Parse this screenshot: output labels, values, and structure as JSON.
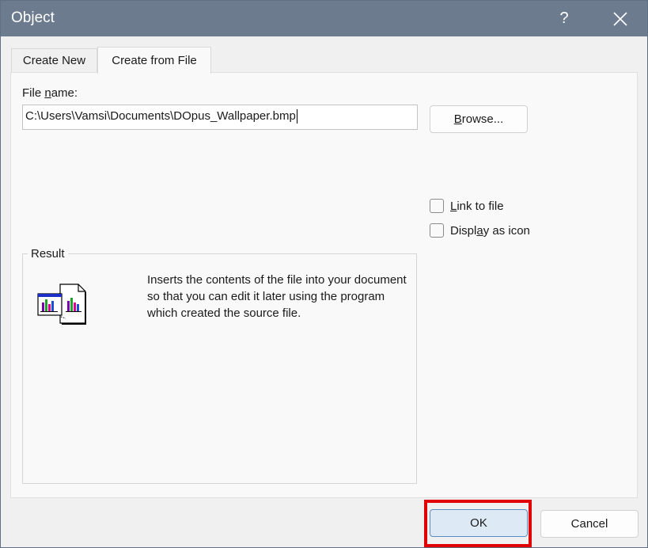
{
  "window": {
    "title": "Object",
    "help": "?",
    "close_icon": "close-icon"
  },
  "tabs": [
    {
      "label": "Create New",
      "selected": false
    },
    {
      "label": "Create from File",
      "selected": true
    }
  ],
  "file_name": {
    "label_prefix": "File ",
    "label_accel": "n",
    "label_suffix": "ame:",
    "value": "C:\\Users\\Vamsi\\Documents\\DOpus_Wallpaper.bmp"
  },
  "browse": {
    "accel": "B",
    "rest": "rowse..."
  },
  "options": {
    "link": {
      "accel": "L",
      "rest": "ink to file",
      "checked": false
    },
    "display_icon": {
      "pre": "Displ",
      "accel": "a",
      "rest": "y as icon",
      "checked": false
    }
  },
  "result": {
    "legend": "Result",
    "text": "Inserts the contents of the file into your document so that you can edit it later using the program which created the source file.",
    "icon": "embedded-object-icon"
  },
  "buttons": {
    "ok": "OK",
    "cancel": "Cancel"
  },
  "colors": {
    "titlebar": "#6d7b8f",
    "highlight": "#e00000",
    "ok_fill": "#dde9f5"
  }
}
